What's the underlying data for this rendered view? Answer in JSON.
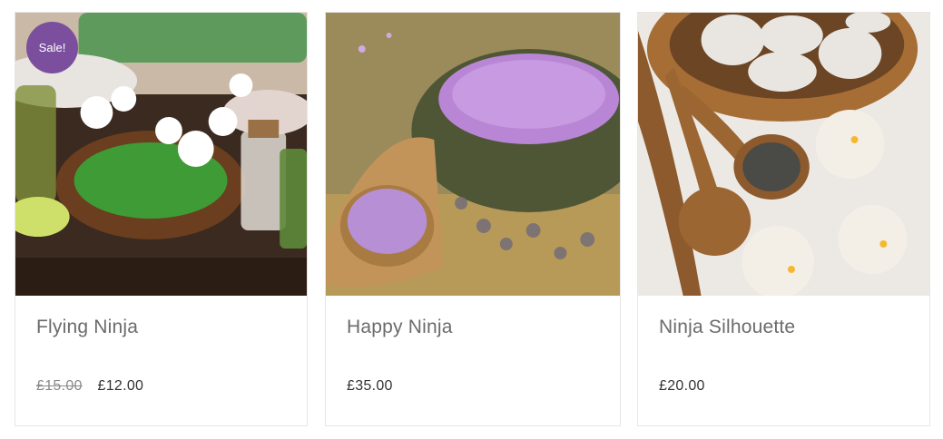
{
  "products": [
    {
      "title": "Flying Ninja",
      "badge": "Sale!",
      "old_price": "£15.00",
      "price": "£12.00"
    },
    {
      "title": "Happy Ninja",
      "price": "£35.00"
    },
    {
      "title": "Ninja Silhouette",
      "price": "£20.00"
    }
  ],
  "colors": {
    "badge": "#7b4f9e",
    "title": "#6b6b6b",
    "price": "#333333",
    "border": "#e6e6e6"
  }
}
